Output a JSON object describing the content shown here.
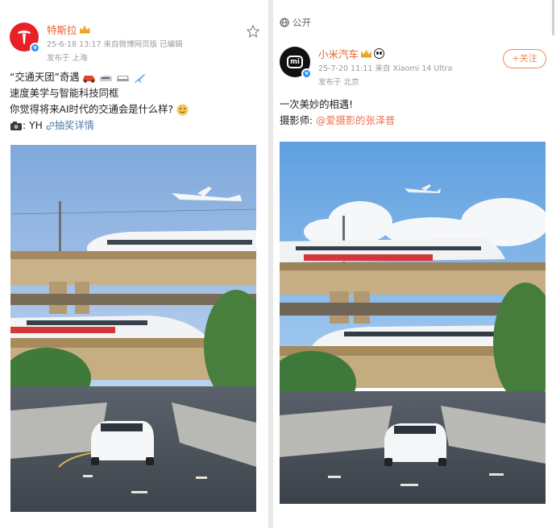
{
  "left_post": {
    "username": "特斯拉",
    "timestamp": "25-6-18 13:17",
    "source": "来自微博网页版",
    "edited": "已编辑",
    "location": "发布于 上海",
    "line1_quote": "“交通天团”",
    "line1_rest": "奇遇",
    "line2": "速度美学与智能科技同框",
    "line3": "你觉得将来AI时代的交通会是什么样?",
    "credit_name": "YH",
    "lottery_link": "抽奖详情",
    "avatar_icon": "tesla-logo-icon"
  },
  "right_post": {
    "visibility": "公开",
    "username": "小米汽车",
    "timestamp": "25-7-20 11:11",
    "source": "来自 Xiaomi 14 Ultra",
    "location": "发布于 北京",
    "follow_label": "+关注",
    "line1": "一次美妙的相遇!",
    "photographer_label": "摄影师:",
    "photographer_mention": "@爱摄影的张泽普",
    "avatar_text": "mi"
  },
  "colors": {
    "username": "#e8602c",
    "mention": "#eb7350",
    "link": "#507daf",
    "verified": "#2a8ff7"
  }
}
